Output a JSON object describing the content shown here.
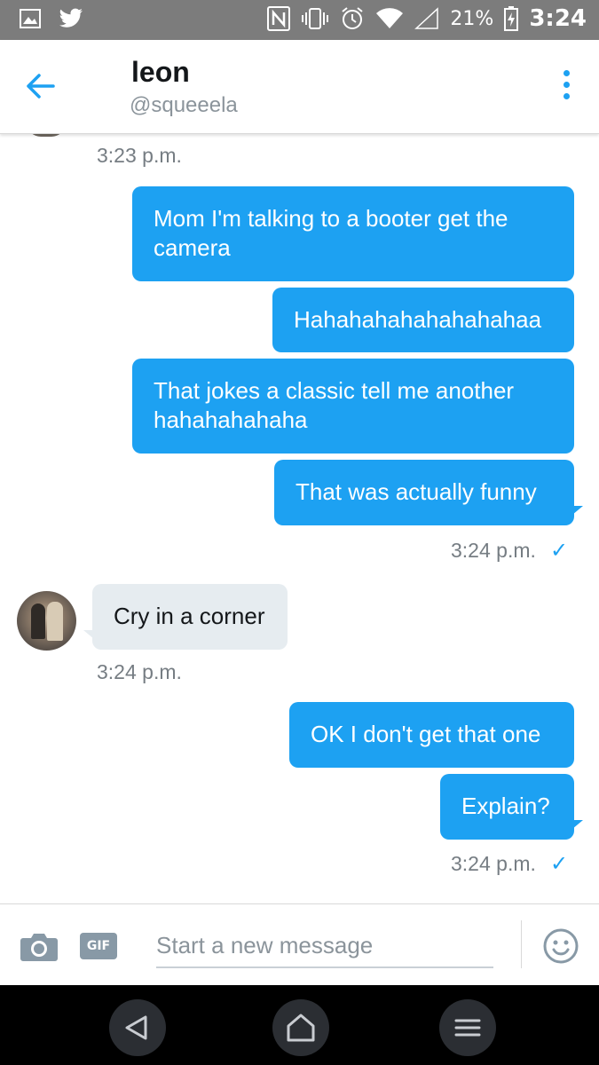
{
  "status_bar": {
    "battery": "21%",
    "time": "3:24",
    "icons": [
      "image-icon",
      "twitter-icon",
      "nfc-icon",
      "vibrate-icon",
      "alarm-icon",
      "wifi-icon",
      "signal-icon",
      "battery-charging-icon"
    ]
  },
  "header": {
    "name": "leon",
    "handle": "@squeeela",
    "back_icon": "back-arrow-icon",
    "menu_icon": "more-vertical-icon"
  },
  "messages": [
    {
      "time": "3:23 p.m."
    },
    {
      "direction": "out",
      "text": "Mom I'm talking to a booter get the camera"
    },
    {
      "direction": "out",
      "text": "Hahahahahahahahahaa"
    },
    {
      "direction": "out",
      "text": "That jokes a classic tell me another hahahahahaha"
    },
    {
      "direction": "out",
      "text": "That was actually funny"
    },
    {
      "time": "3:24 p.m.",
      "read_check": "✓"
    },
    {
      "direction": "in",
      "text": "Cry in a corner"
    },
    {
      "time": "3:24 p.m."
    },
    {
      "direction": "out",
      "text": "OK I don't get that one"
    },
    {
      "direction": "out",
      "text": "Explain?"
    },
    {
      "time": "3:24 p.m.",
      "read_check": "✓"
    }
  ],
  "composer": {
    "placeholder": "Start a new message",
    "gif_label": "GIF",
    "camera_icon": "camera-icon",
    "emoji_icon": "emoji-icon"
  },
  "colors": {
    "accent": "#1da1f2",
    "incoming_bubble": "#e6ecf0",
    "status_bar": "#7c7c7c"
  }
}
